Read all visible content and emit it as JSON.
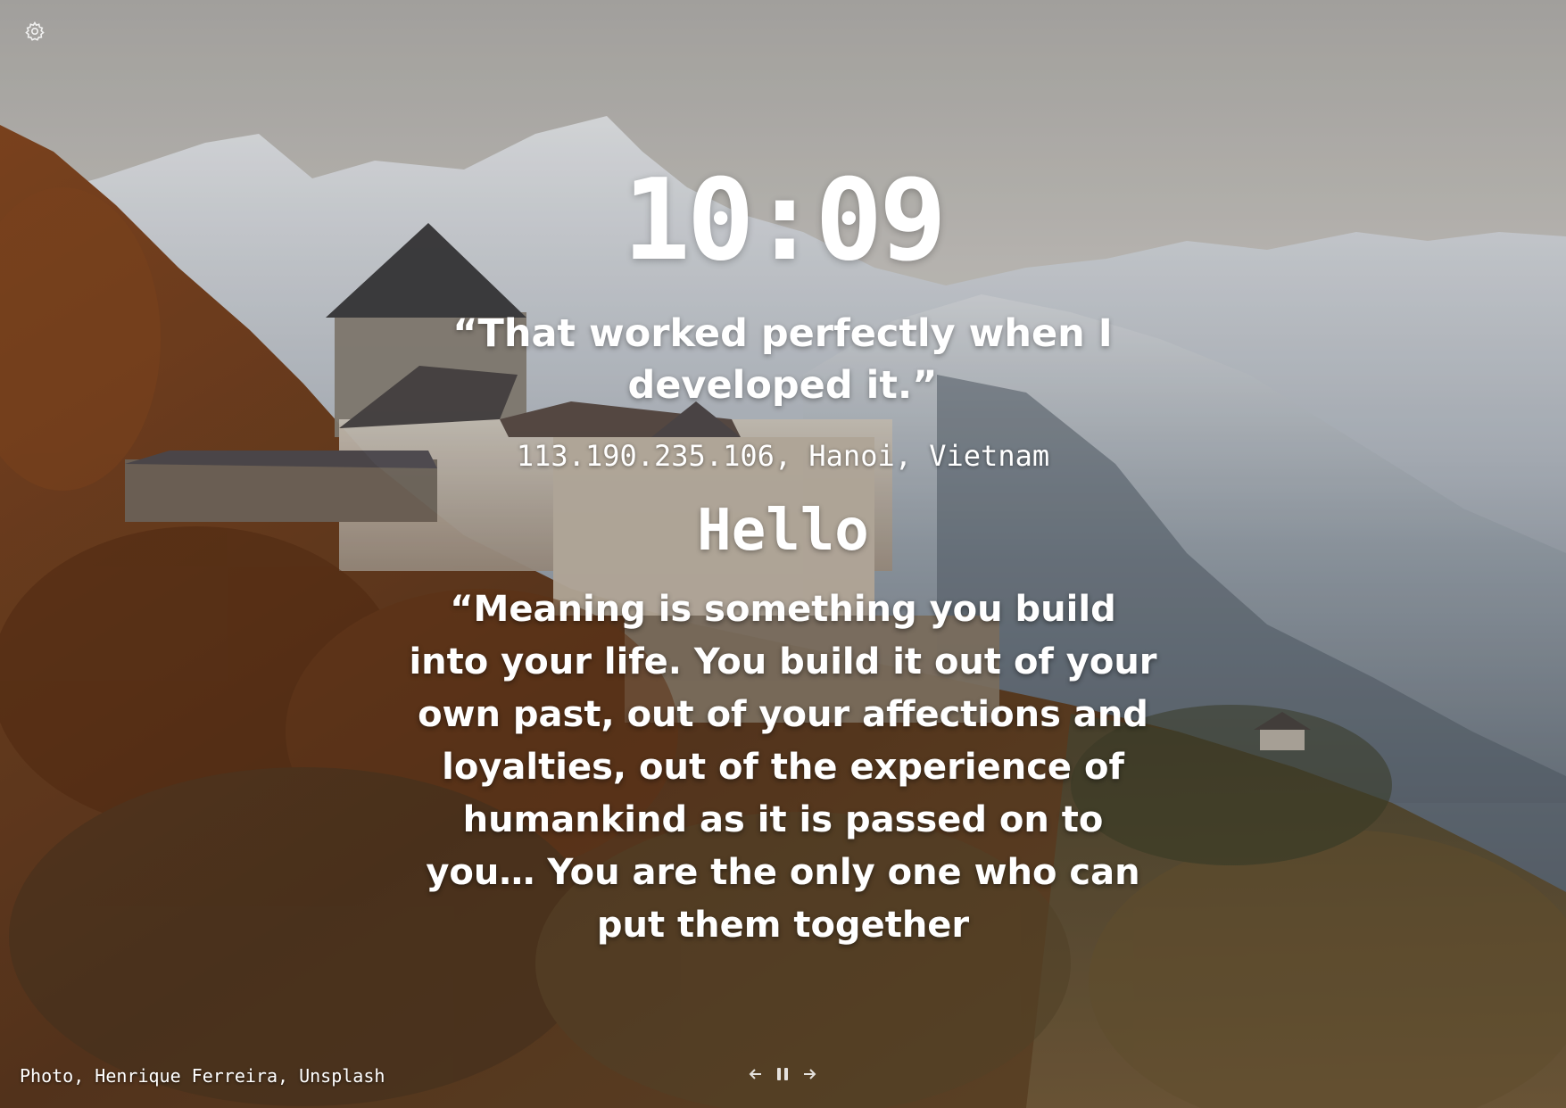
{
  "clock": {
    "time": "10:09"
  },
  "top_quote": {
    "text": "“That worked perfectly when I developed it.”"
  },
  "location": {
    "text": "113.190.235.106, Hanoi, Vietnam"
  },
  "greeting": {
    "text": "Hello"
  },
  "main_quote": {
    "text": "“Meaning is something you build into your life. You build it out of your own past, out of your affections and loyalties, out of the experience of humankind as it is passed on to you… You are the only one who can put them together"
  },
  "footer": {
    "photo_credit": "Photo, Henrique Ferreira, Unsplash"
  },
  "controls": {
    "previous_icon": "arrow-left-icon",
    "pause_icon": "pause-icon",
    "next_icon": "arrow-right-icon"
  },
  "settings": {
    "icon": "gear-icon"
  },
  "colors": {
    "text": "#ffffff",
    "sky": "#c9c6c1",
    "mountain_snow": "#e6e8ec",
    "mountain_shadow": "#7d8793",
    "forest": "#6b3d1e"
  }
}
